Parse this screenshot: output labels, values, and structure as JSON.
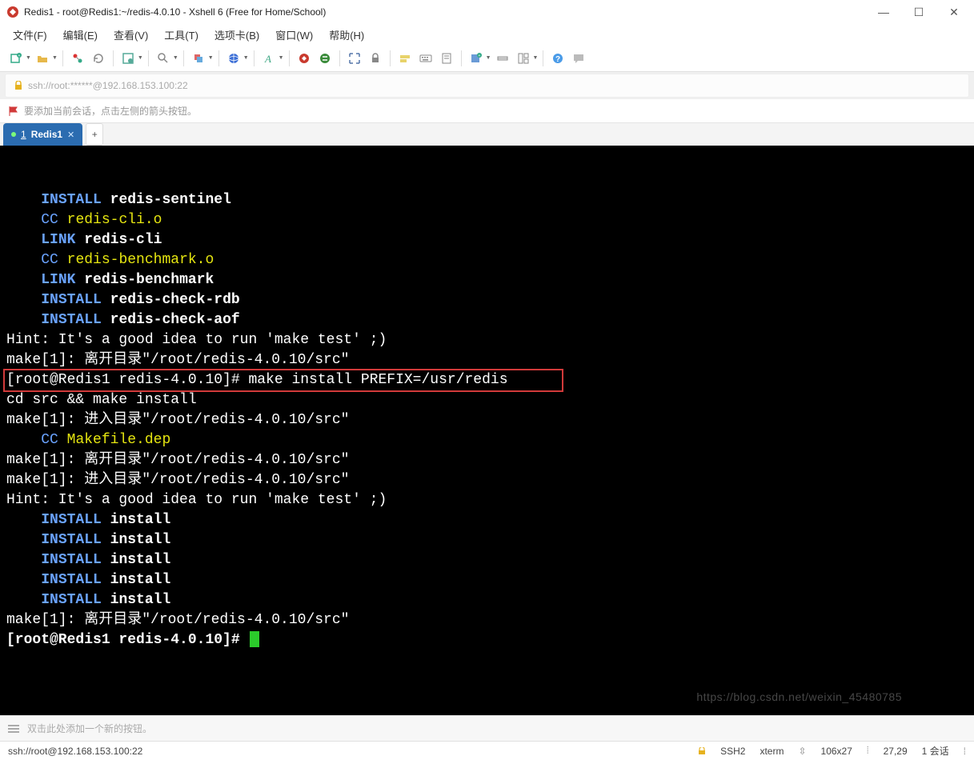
{
  "window": {
    "title": "Redis1 - root@Redis1:~/redis-4.0.10 - Xshell 6 (Free for Home/School)"
  },
  "menubar": {
    "items": [
      {
        "label": "文件(F)"
      },
      {
        "label": "编辑(E)"
      },
      {
        "label": "查看(V)"
      },
      {
        "label": "工具(T)"
      },
      {
        "label": "选项卡(B)"
      },
      {
        "label": "窗口(W)"
      },
      {
        "label": "帮助(H)"
      }
    ]
  },
  "addressbar": {
    "url": "ssh://root:******@192.168.153.100:22"
  },
  "session_hint": {
    "text": "要添加当前会话，点击左侧的箭头按钮。"
  },
  "tabs": {
    "active": {
      "index": "1",
      "label": "Redis1"
    },
    "add_label": "+"
  },
  "terminal": {
    "lines": [
      {
        "segments": [
          {
            "t": "    "
          },
          {
            "t": "INSTALL",
            "c": "term-install"
          },
          {
            "t": " "
          },
          {
            "t": "redis-sentinel",
            "c": "term-white"
          }
        ]
      },
      {
        "segments": [
          {
            "t": "    "
          },
          {
            "t": "CC",
            "c": "term-cc"
          },
          {
            "t": " "
          },
          {
            "t": "redis-cli.o",
            "c": "term-yellow"
          }
        ]
      },
      {
        "segments": [
          {
            "t": "    "
          },
          {
            "t": "LINK",
            "c": "term-link"
          },
          {
            "t": " "
          },
          {
            "t": "redis-cli",
            "c": "term-white"
          }
        ]
      },
      {
        "segments": [
          {
            "t": "    "
          },
          {
            "t": "CC",
            "c": "term-cc"
          },
          {
            "t": " "
          },
          {
            "t": "redis-benchmark.o",
            "c": "term-yellow"
          }
        ]
      },
      {
        "segments": [
          {
            "t": "    "
          },
          {
            "t": "LINK",
            "c": "term-link"
          },
          {
            "t": " "
          },
          {
            "t": "redis-benchmark",
            "c": "term-white"
          }
        ]
      },
      {
        "segments": [
          {
            "t": "    "
          },
          {
            "t": "INSTALL",
            "c": "term-install"
          },
          {
            "t": " "
          },
          {
            "t": "redis-check-rdb",
            "c": "term-white"
          }
        ]
      },
      {
        "segments": [
          {
            "t": "    "
          },
          {
            "t": "INSTALL",
            "c": "term-install"
          },
          {
            "t": " "
          },
          {
            "t": "redis-check-aof",
            "c": "term-white"
          }
        ]
      },
      {
        "segments": [
          {
            "t": ""
          }
        ]
      },
      {
        "segments": [
          {
            "t": "Hint: It's a good idea to run 'make test' ;)",
            "c": "term-dim"
          }
        ]
      },
      {
        "segments": [
          {
            "t": ""
          }
        ]
      },
      {
        "segments": [
          {
            "t": "make[1]: 离开目录\"/root/redis-4.0.10/src\"",
            "c": "term-dim"
          }
        ]
      },
      {
        "segments": [
          {
            "t": "[root@Redis1 redis-4.0.10]# make install PREFIX=/usr/redis",
            "c": "term-dim"
          }
        ],
        "highlight": true
      },
      {
        "segments": [
          {
            "t": "cd src && make install",
            "c": "term-dim"
          }
        ]
      },
      {
        "segments": [
          {
            "t": "make[1]: 进入目录\"/root/redis-4.0.10/src\"",
            "c": "term-dim"
          }
        ]
      },
      {
        "segments": [
          {
            "t": "    "
          },
          {
            "t": "CC",
            "c": "term-cc"
          },
          {
            "t": " "
          },
          {
            "t": "Makefile.dep",
            "c": "term-yellow"
          }
        ]
      },
      {
        "segments": [
          {
            "t": "make[1]: 离开目录\"/root/redis-4.0.10/src\"",
            "c": "term-dim"
          }
        ]
      },
      {
        "segments": [
          {
            "t": "make[1]: 进入目录\"/root/redis-4.0.10/src\"",
            "c": "term-dim"
          }
        ]
      },
      {
        "segments": [
          {
            "t": ""
          }
        ]
      },
      {
        "segments": [
          {
            "t": "Hint: It's a good idea to run 'make test' ;)",
            "c": "term-dim"
          }
        ]
      },
      {
        "segments": [
          {
            "t": ""
          }
        ]
      },
      {
        "segments": [
          {
            "t": "    "
          },
          {
            "t": "INSTALL",
            "c": "term-install"
          },
          {
            "t": " "
          },
          {
            "t": "install",
            "c": "term-white"
          }
        ]
      },
      {
        "segments": [
          {
            "t": "    "
          },
          {
            "t": "INSTALL",
            "c": "term-install"
          },
          {
            "t": " "
          },
          {
            "t": "install",
            "c": "term-white"
          }
        ]
      },
      {
        "segments": [
          {
            "t": "    "
          },
          {
            "t": "INSTALL",
            "c": "term-install"
          },
          {
            "t": " "
          },
          {
            "t": "install",
            "c": "term-white"
          }
        ]
      },
      {
        "segments": [
          {
            "t": "    "
          },
          {
            "t": "INSTALL",
            "c": "term-install"
          },
          {
            "t": " "
          },
          {
            "t": "install",
            "c": "term-white"
          }
        ]
      },
      {
        "segments": [
          {
            "t": "    "
          },
          {
            "t": "INSTALL",
            "c": "term-install"
          },
          {
            "t": " "
          },
          {
            "t": "install",
            "c": "term-white"
          }
        ]
      },
      {
        "segments": [
          {
            "t": "make[1]: 离开目录\"/root/redis-4.0.10/src\"",
            "c": "term-dim"
          }
        ]
      },
      {
        "segments": [
          {
            "t": "[root@Redis1 redis-4.0.10]# ",
            "c": "term-white"
          }
        ],
        "cursor": true
      }
    ]
  },
  "compose": {
    "placeholder": "双击此处添加一个新的按钮。"
  },
  "statusbar": {
    "left": "ssh://root@192.168.153.100:22",
    "ssh": "SSH2",
    "term": "xterm",
    "size": "106x27",
    "pos": "27,29",
    "sessions": "1 会话"
  },
  "watermark": "https://blog.csdn.net/weixin_45480785"
}
